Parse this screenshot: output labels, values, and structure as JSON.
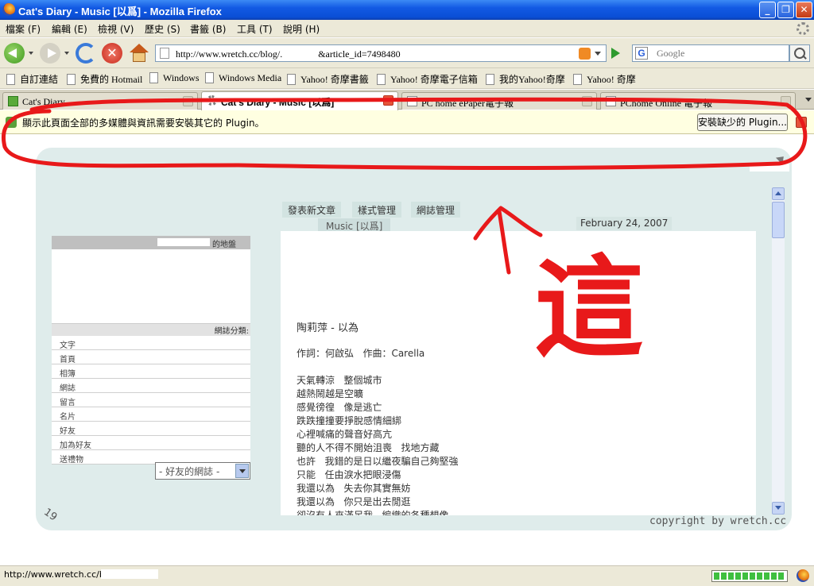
{
  "window": {
    "title": "Cat's Diary - Music [以爲] - Mozilla Firefox"
  },
  "menu": [
    {
      "label": "檔案 (F)"
    },
    {
      "label": "編輯 (E)"
    },
    {
      "label": "檢視 (V)"
    },
    {
      "label": "歷史 (S)"
    },
    {
      "label": "書籤 (B)"
    },
    {
      "label": "工具 (T)"
    },
    {
      "label": "說明 (H)"
    }
  ],
  "nav": {
    "url": "http://www.wretch.cc/blog/.               &article_id=7498480",
    "search_placeholder": "Google",
    "search_engine_icon": "G"
  },
  "bookmarks": [
    {
      "label": "自訂連結"
    },
    {
      "label": "免費的 Hotmail"
    },
    {
      "label": "Windows"
    },
    {
      "label": "Windows Media"
    },
    {
      "label": "Yahoo! 奇摩書籤"
    },
    {
      "label": "Yahoo! 奇摩電子信箱"
    },
    {
      "label": "我的Yahoo!奇摩"
    },
    {
      "label": "Yahoo! 奇摩"
    }
  ],
  "tabs": [
    {
      "label": "Cat's Diary"
    },
    {
      "label": "Cat's Diary - Music [以爲]"
    },
    {
      "label": "PC home ePaper電子報"
    },
    {
      "label": "PChome Online 電子報"
    }
  ],
  "notification": {
    "text": "顯示此頁面全部的多媒體與資訊需要安裝其它的 Plugin。",
    "button": "安裝缺少的 Plugin..."
  },
  "blog": {
    "top_links": [
      {
        "label": "發表新文章"
      },
      {
        "label": "樣式管理"
      },
      {
        "label": "網誌管理"
      }
    ],
    "category": "Music [以爲]",
    "date": "February 24, 2007",
    "sidebar": {
      "title": "的地盤",
      "subtitle": "網誌分類:",
      "items": [
        {
          "label": "文字"
        },
        {
          "label": "首頁"
        },
        {
          "label": "相簿"
        },
        {
          "label": "網誌"
        },
        {
          "label": "留言"
        },
        {
          "label": "名片"
        },
        {
          "label": "好友"
        },
        {
          "label": "加為好友"
        },
        {
          "label": "送禮物"
        }
      ],
      "friend_select": "- 好友的網誌 -"
    },
    "post": {
      "title": "陶莉萍 - 以為",
      "credits": "作詞：何啟弘   作曲：Carella",
      "lyrics": [
        "天氣轉涼   整個城市",
        "越熱鬧越是空曠",
        "感覺徬徨   像是逃亡",
        "跌跌撞撞要掙脫感情細綁",
        "心裡喊痛的聲音好高亢",
        "聽的人不得不開始沮喪   找地方藏",
        "也許   我錯的是日以繼夜騙自己夠堅強",
        "只能   任由淚水把眼浸傷",
        "我還以為   失去你其實無妨",
        "我還以為   你只是出去閒逛",
        "卻沒有人來滿足我   編織的各種想像"
      ]
    },
    "page_number": "19",
    "copyright": "copyright by wretch.cc"
  },
  "annotation": {
    "text": "這",
    "color": "#e8191a"
  },
  "status": {
    "text": "http://www.wretch.cc/blog",
    "progress": 1.0
  }
}
